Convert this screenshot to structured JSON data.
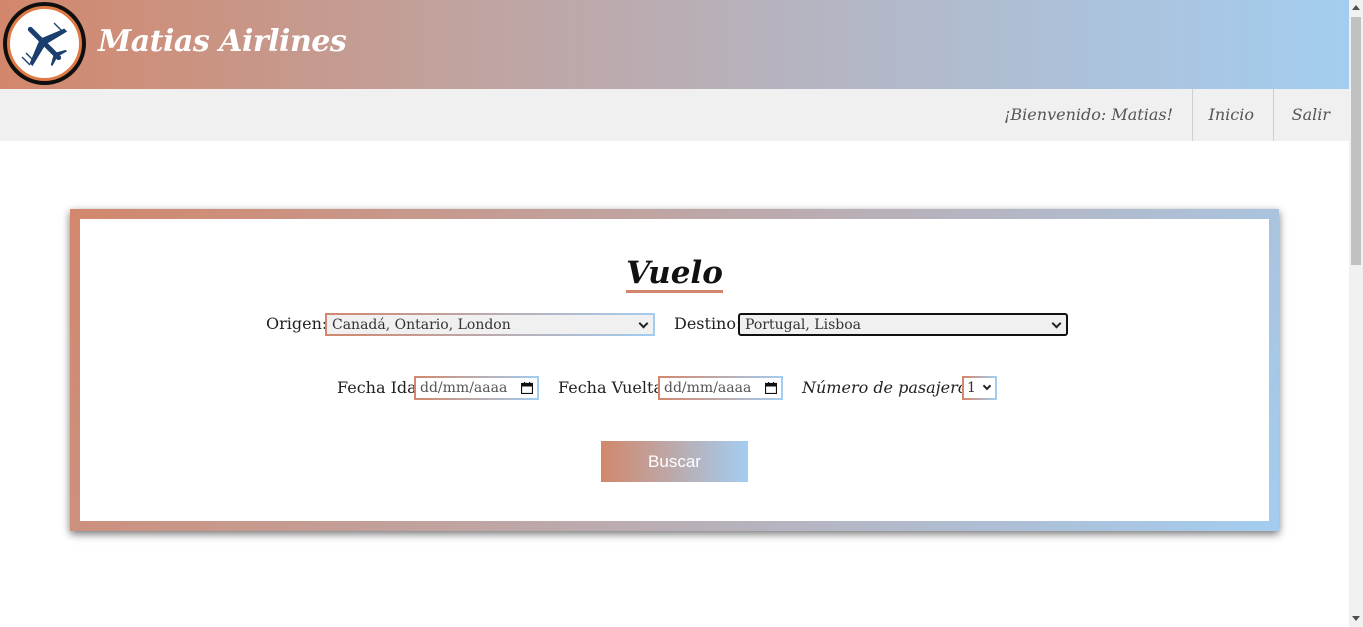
{
  "header": {
    "brand": "Matias Airlines",
    "logo_icon": "airplane-icon"
  },
  "nav": {
    "welcome": "¡Bienvenido: Matias!",
    "inicio": "Inicio",
    "salir": "Salir"
  },
  "form": {
    "title": "Vuelo",
    "origen_label": "Origen:",
    "origen_value": "Canadá, Ontario, London",
    "destino_label": "Destino:",
    "destino_value": "Portugal, Lisboa",
    "fecha_ida_label": "Fecha Ida:",
    "fecha_ida_placeholder": "dd/mm/aaaa",
    "fecha_vuelta_label": "Fecha Vuelta:",
    "fecha_vuelta_placeholder": "dd/mm/aaaa",
    "pasajeros_label": "Número de pasajeros:",
    "pasajeros_value": "1",
    "search_button": "Buscar"
  },
  "colors": {
    "gradient_start": "#d2876c",
    "gradient_end": "#a3cdf0",
    "navbar_bg": "#f0f0f0"
  }
}
